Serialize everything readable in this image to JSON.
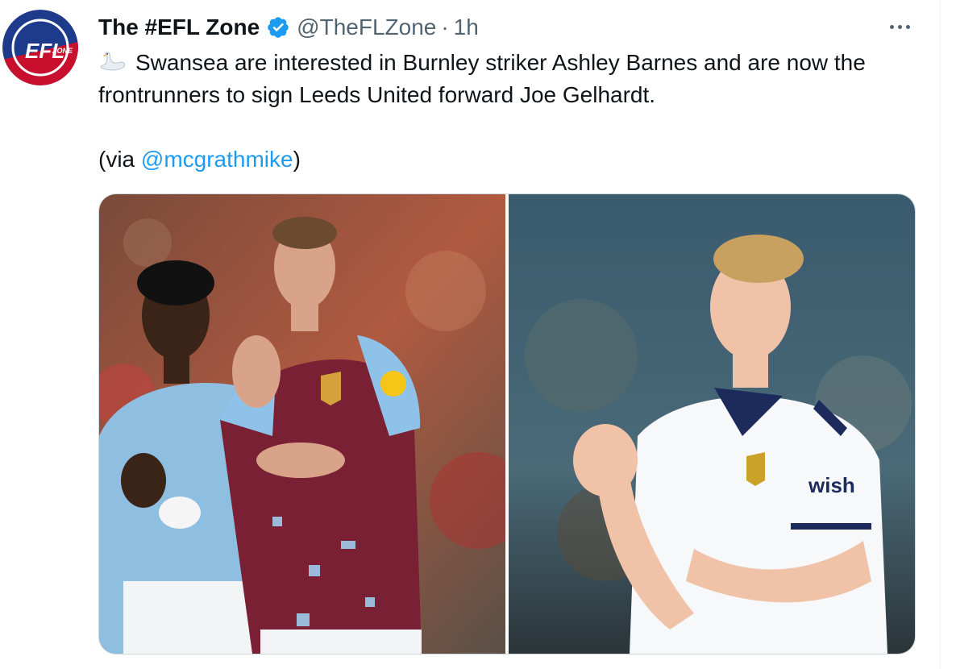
{
  "tweet": {
    "author": {
      "display_name": "The #EFL Zone",
      "handle": "@TheFLZone",
      "separator": "·",
      "time": "1h",
      "verified": true,
      "avatar_text": "EFL ZONE"
    },
    "text": {
      "emoji": "swan-emoji",
      "main": "Swansea are interested in Burnley striker Ashley Barnes and are now the frontrunners to sign Leeds United forward Joe Gelhardt.",
      "via_prefix": "(via ",
      "via_mention": "@mcgrathmike",
      "via_suffix": ")"
    },
    "media": [
      {
        "subject": "Ashley Barnes applauding in Burnley kit",
        "icon": "photo"
      },
      {
        "subject": "Joe Gelhardt applauding in Leeds United kit",
        "icon": "photo"
      }
    ],
    "more_icon": "more-dots-icon"
  },
  "colors": {
    "text": "#0f1419",
    "secondary": "#536471",
    "link": "#1d9bf0",
    "verified": "#1d9bf0",
    "border": "#cfd9de",
    "avatar_red": "#c8102e",
    "avatar_blue": "#1e3a8a"
  }
}
